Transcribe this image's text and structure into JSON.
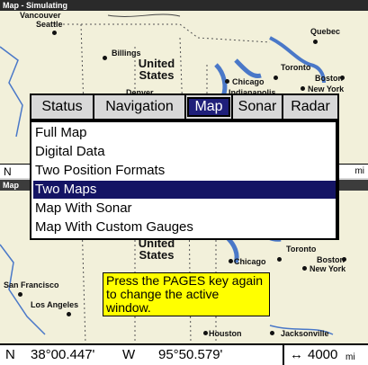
{
  "top_pane": {
    "title": "Map - Simulating",
    "cities": [
      "Vancouver",
      "Seattle",
      "Billings",
      "Quebec",
      "Toronto",
      "Boston",
      "Chicago",
      "New York",
      "Denver",
      "Indianapolis"
    ],
    "region": "United States",
    "nav_left": "N",
    "nav_right": "mi"
  },
  "bottom_pane": {
    "title": "Map",
    "cities": [
      "San Francisco",
      "Los Angeles",
      "Toronto",
      "Boston",
      "Chicago",
      "New York",
      "Houston",
      "Jacksonville"
    ],
    "region": "United States"
  },
  "menu": {
    "tabs": [
      {
        "label": "Status",
        "selected": false
      },
      {
        "label": "Navigation",
        "selected": false
      },
      {
        "label": "Map",
        "selected": true
      },
      {
        "label": "Sonar",
        "selected": false
      },
      {
        "label": "Radar",
        "selected": false
      }
    ],
    "items": [
      {
        "label": "Full Map",
        "selected": false
      },
      {
        "label": "Digital Data",
        "selected": false
      },
      {
        "label": "Two Position Formats",
        "selected": false
      },
      {
        "label": "Two Maps",
        "selected": true
      },
      {
        "label": "Map With Sonar",
        "selected": false
      },
      {
        "label": "Map With Custom Gauges",
        "selected": false
      }
    ]
  },
  "tooltip": {
    "text": "Press the PAGES key again to change the active window."
  },
  "status_bar": {
    "lat_hemisphere": "N",
    "latitude": "38°00.447'",
    "lon_hemisphere": "W",
    "longitude": "95°50.579'",
    "scale_icon": "↔",
    "scale_value": "4000",
    "scale_unit": "mi"
  },
  "colors": {
    "map_land": "#f2f0da",
    "menu_selected": "#141464",
    "tooltip_bg": "#ffff00",
    "title_bar": "#2a2a2a"
  }
}
